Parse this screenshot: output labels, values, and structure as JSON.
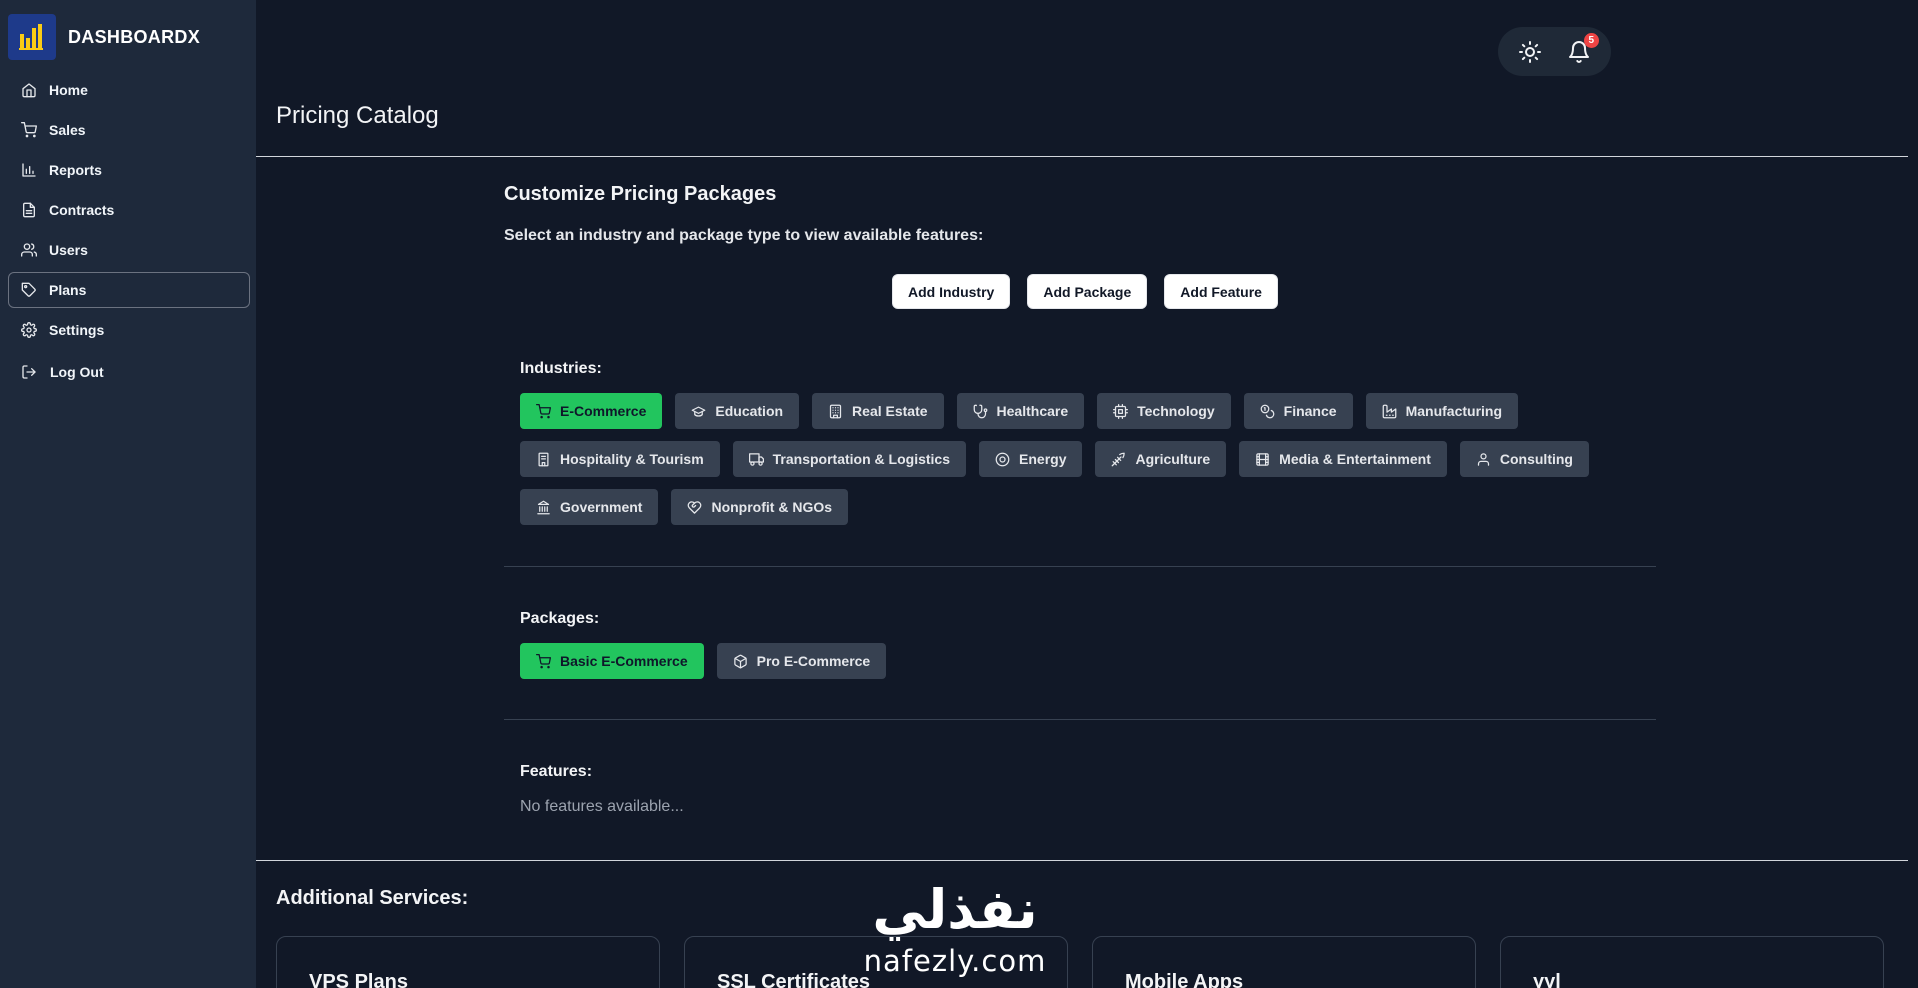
{
  "app": {
    "name": "DASHBOARDX"
  },
  "sidebar": {
    "items": [
      {
        "label": "Home",
        "icon": "home-icon"
      },
      {
        "label": "Sales",
        "icon": "cart-icon"
      },
      {
        "label": "Reports",
        "icon": "bar-chart-icon"
      },
      {
        "label": "Contracts",
        "icon": "document-icon"
      },
      {
        "label": "Users",
        "icon": "users-icon"
      },
      {
        "label": "Plans",
        "icon": "tag-icon",
        "active": true
      },
      {
        "label": "Settings",
        "icon": "gear-icon"
      }
    ],
    "logout_label": "Log Out"
  },
  "header": {
    "notifications_count": "5",
    "theme_icon": "sun-icon",
    "bell_icon": "bell-icon"
  },
  "page": {
    "title": "Pricing Catalog",
    "section_title": "Customize Pricing Packages",
    "subtitle": "Select an industry and package type to view available features:",
    "actions": {
      "add_industry": "Add Industry",
      "add_package": "Add Package",
      "add_feature": "Add Feature"
    }
  },
  "industries": {
    "label": "Industries:",
    "selected": "E-Commerce",
    "items": [
      {
        "label": "E-Commerce",
        "icon": "cart-icon"
      },
      {
        "label": "Education",
        "icon": "graduation-cap-icon"
      },
      {
        "label": "Real Estate",
        "icon": "building-icon"
      },
      {
        "label": "Healthcare",
        "icon": "stethoscope-icon"
      },
      {
        "label": "Technology",
        "icon": "cpu-icon"
      },
      {
        "label": "Finance",
        "icon": "coins-icon"
      },
      {
        "label": "Manufacturing",
        "icon": "factory-icon"
      },
      {
        "label": "Hospitality & Tourism",
        "icon": "hotel-icon"
      },
      {
        "label": "Transportation & Logistics",
        "icon": "truck-icon"
      },
      {
        "label": "Energy",
        "icon": "energy-icon"
      },
      {
        "label": "Agriculture",
        "icon": "leaf-icon"
      },
      {
        "label": "Media & Entertainment",
        "icon": "film-icon"
      },
      {
        "label": "Consulting",
        "icon": "user-icon"
      },
      {
        "label": "Government",
        "icon": "landmark-icon"
      },
      {
        "label": "Nonprofit & NGOs",
        "icon": "heart-handshake-icon"
      }
    ]
  },
  "packages": {
    "label": "Packages:",
    "selected": "Basic E-Commerce",
    "items": [
      {
        "label": "Basic E-Commerce",
        "icon": "cart-icon"
      },
      {
        "label": "Pro E-Commerce",
        "icon": "box-icon"
      }
    ]
  },
  "features": {
    "label": "Features:",
    "empty_text": "No features available..."
  },
  "services": {
    "title": "Additional Services:",
    "items": [
      {
        "name": "VPS Plans"
      },
      {
        "name": "SSL Certificates"
      },
      {
        "name": "Mobile Apps"
      },
      {
        "name": "yyl"
      }
    ]
  },
  "watermark": {
    "arabic": "نفذلي",
    "latin": "nafezly.com"
  },
  "colors": {
    "accent_selected": "#22c55e",
    "sidebar_bg": "#1e293b",
    "page_bg": "#111827",
    "chip_bg": "#374151",
    "badge": "#ef4444"
  }
}
